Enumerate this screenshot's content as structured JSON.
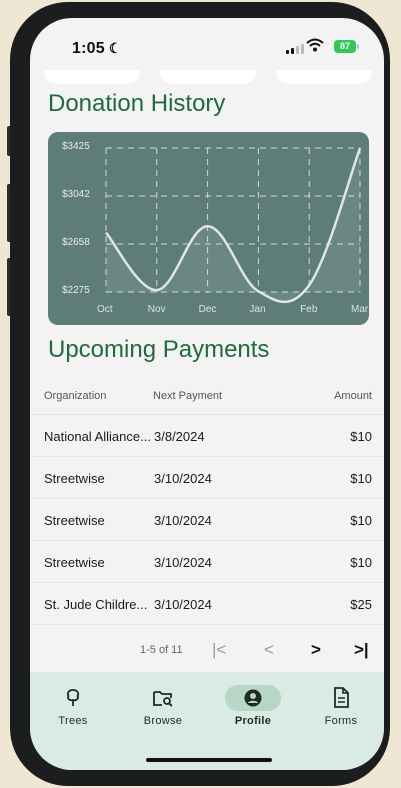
{
  "status": {
    "time": "1:05",
    "battery": "87"
  },
  "history": {
    "title": "Donation History",
    "chart_data": {
      "type": "line",
      "categories": [
        "Oct",
        "Nov",
        "Dec",
        "Jan",
        "Feb",
        "Mar"
      ],
      "values": [
        2750,
        2290,
        2800,
        2280,
        2330,
        3425
      ],
      "y_ticks": [
        "$3425",
        "$3042",
        "$2658",
        "$2275"
      ],
      "ylim": [
        2275,
        3425
      ],
      "grid": true
    }
  },
  "upcoming": {
    "title": "Upcoming Payments",
    "columns": [
      "Organization",
      "Next Payment",
      "Amount"
    ],
    "rows": [
      {
        "organization": "National Alliance...",
        "date": "3/8/2024",
        "amount": "$10"
      },
      {
        "organization": "Streetwise",
        "date": "3/10/2024",
        "amount": "$10"
      },
      {
        "organization": "Streetwise",
        "date": "3/10/2024",
        "amount": "$10"
      },
      {
        "organization": "Streetwise",
        "date": "3/10/2024",
        "amount": "$10"
      },
      {
        "organization": "St. Jude Childre...",
        "date": "3/10/2024",
        "amount": "$25"
      }
    ],
    "pagination": {
      "info": "1-5 of 11",
      "first": "|<",
      "prev": "<",
      "next": ">",
      "last": ">|"
    }
  },
  "nav": {
    "items": [
      {
        "label": "Trees",
        "icon": "tree-icon",
        "active": false
      },
      {
        "label": "Browse",
        "icon": "browse-icon",
        "active": false
      },
      {
        "label": "Profile",
        "icon": "profile-icon",
        "active": true
      },
      {
        "label": "Forms",
        "icon": "forms-icon",
        "active": false
      }
    ]
  },
  "colors": {
    "accent": "#1e6b3f",
    "chart_bg": "#5f7d78",
    "nav_bg": "#d9ebe3"
  }
}
